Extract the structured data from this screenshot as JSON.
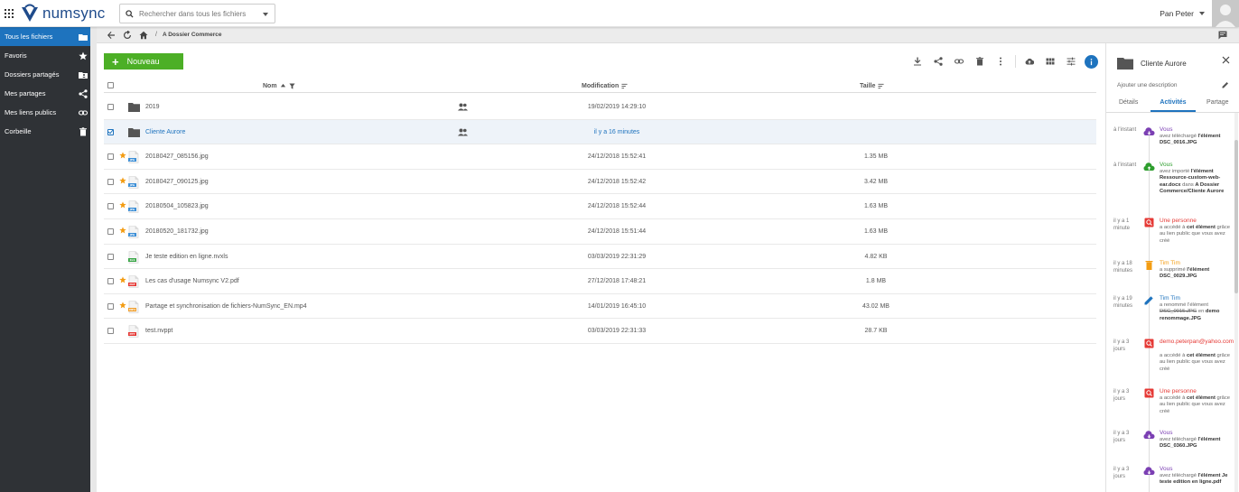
{
  "app": {
    "name": "numsync"
  },
  "search": {
    "placeholder": "Rechercher dans tous les fichiers"
  },
  "user": {
    "name": "Pan Peter"
  },
  "sidebar": {
    "items": [
      {
        "label": "Tous les fichiers",
        "icon": "folder-icon",
        "active": true
      },
      {
        "label": "Favoris",
        "icon": "star-icon"
      },
      {
        "label": "Dossiers partagés",
        "icon": "shared-folder-icon"
      },
      {
        "label": "Mes partages",
        "icon": "share-icon"
      },
      {
        "label": "Mes liens publics",
        "icon": "link-icon"
      },
      {
        "label": "Corbeille",
        "icon": "trash-icon"
      }
    ]
  },
  "breadcrumb": {
    "separator": "/",
    "current": "A Dossier Commerce"
  },
  "toolbar": {
    "new_label": "Nouveau"
  },
  "table": {
    "headers": {
      "name": "Nom",
      "modified": "Modification",
      "size": "Taille"
    },
    "rows": [
      {
        "type": "folder",
        "name": "2019",
        "modified": "19/02/2019 14:29:10",
        "size": "",
        "shared": true,
        "favorite": false,
        "selected": false
      },
      {
        "type": "folder",
        "name": "Cliente Aurore",
        "modified": "il y a 16 minutes",
        "size": "",
        "shared": true,
        "favorite": false,
        "selected": true
      },
      {
        "type": "jpg",
        "ext": "JPG",
        "name": "20180427_085156.jpg",
        "modified": "24/12/2018 15:52:41",
        "size": "1.35 MB",
        "favorite": true
      },
      {
        "type": "jpg",
        "ext": "JPG",
        "name": "20180427_090125.jpg",
        "modified": "24/12/2018 15:52:42",
        "size": "3.42 MB",
        "favorite": true
      },
      {
        "type": "jpg",
        "ext": "JPG",
        "name": "20180504_105823.jpg",
        "modified": "24/12/2018 15:52:44",
        "size": "1.63 MB",
        "favorite": true
      },
      {
        "type": "jpg",
        "ext": "JPG",
        "name": "20180520_181732.jpg",
        "modified": "24/12/2018 15:51:44",
        "size": "1.63 MB",
        "favorite": true
      },
      {
        "type": "xls",
        "ext": "XLS",
        "name": "Je teste edition en ligne.nvxls",
        "modified": "03/03/2019 22:31:29",
        "size": "4.82 KB",
        "favorite": false
      },
      {
        "type": "pdf",
        "ext": "PDF",
        "name": "Les cas d'usage Numsync V2.pdf",
        "modified": "27/12/2018 17:48:21",
        "size": "1.8 MB",
        "favorite": true
      },
      {
        "type": "mp4",
        "ext": "MP4",
        "name": "Partage et synchronisation de fichiers-NumSync_EN.mp4",
        "modified": "14/01/2019 16:45:10",
        "size": "43.02 MB",
        "favorite": true
      },
      {
        "type": "ppt",
        "ext": "PPT",
        "name": "test.nvppt",
        "modified": "03/03/2019 22:31:33",
        "size": "28.7 KB",
        "favorite": false
      }
    ]
  },
  "panel": {
    "title": "Cliente Aurore",
    "description_placeholder": "Ajouter une description",
    "tabs": [
      "Détails",
      "Activités",
      "Partage"
    ],
    "active_tab": "Activités",
    "activities": [
      {
        "when": "à l'instant",
        "who": "Vous",
        "who_color": "#7b3fb3",
        "icon": "cloud-download-icon",
        "icon_color": "#7b3fb3",
        "pre": "avez téléchargé ",
        "bold": "l'élément DSC_0016.JPG",
        "mid": "",
        "bold2": "",
        "post": ""
      },
      {
        "when": "à l'instant",
        "who": "Vous",
        "who_color": "#2e9e2e",
        "icon": "cloud-upload-icon",
        "icon_color": "#2e9e2e",
        "pre": "avez importé ",
        "bold": "l'élément Ressource-custom-web-ear.docx",
        "mid": " dans ",
        "bold2": "A Dossier Commerce/Cliente Aurore",
        "post": ""
      },
      {
        "when": "il y a 1 minute",
        "who": "Une personne",
        "who_color": "#e53935",
        "icon": "search-icon",
        "icon_color": "#e53935",
        "pre": "a accédé à ",
        "bold": "cet élément",
        "mid": "",
        "bold2": "",
        "post": " grâce au lien public que vous avez créé"
      },
      {
        "when": "il y a 18 minutes",
        "who": "Tim Tim",
        "who_color": "#f39c12",
        "icon": "trash-icon",
        "icon_color": "#f39c12",
        "pre": "a supprimé ",
        "bold": "l'élément DSC_0029.JPG",
        "mid": "",
        "bold2": "",
        "post": ""
      },
      {
        "when": "il y a 19 minutes",
        "who": "Tim Tim",
        "who_color": "#1e73be",
        "icon": "pencil-icon",
        "icon_color": "#1e73be",
        "pre": "a renommé l'élément ",
        "strike": "DSC_0015.JPG",
        "mid": " en ",
        "bold2": "demo renommage.JPG",
        "post": ""
      },
      {
        "when": "il y a 3 jours",
        "who": "demo.peterpan@yahoo.com",
        "who_color": "#e53935",
        "icon": "search-icon",
        "icon_color": "#e53935",
        "pre": "a accédé à ",
        "bold": "cet élément",
        "mid": "",
        "bold2": "",
        "post": " grâce au lien public que vous avez créé"
      },
      {
        "when": "il y a 3 jours",
        "who": "Une personne",
        "who_color": "#e53935",
        "icon": "search-icon",
        "icon_color": "#e53935",
        "pre": "a accédé à ",
        "bold": "cet élément",
        "mid": "",
        "bold2": "",
        "post": " grâce au lien public que vous avez créé"
      },
      {
        "when": "il y a 3 jours",
        "who": "Vous",
        "who_color": "#7b3fb3",
        "icon": "cloud-download-icon",
        "icon_color": "#7b3fb3",
        "pre": "avez téléchargé ",
        "bold": "l'élément DSC_0360.JPG",
        "mid": "",
        "bold2": "",
        "post": ""
      },
      {
        "when": "il y a 3 jours",
        "who": "Vous",
        "who_color": "#7b3fb3",
        "icon": "cloud-download-icon",
        "icon_color": "#7b3fb3",
        "pre": "avez téléchargé ",
        "bold": "l'élément Je teste edition en ligne.pdf",
        "mid": "",
        "bold2": "",
        "post": ""
      }
    ]
  },
  "colors": {
    "accent": "#1e73be",
    "new_button": "#4caf26",
    "sidebar_bg": "#2f3236",
    "star": "#f39c12"
  }
}
